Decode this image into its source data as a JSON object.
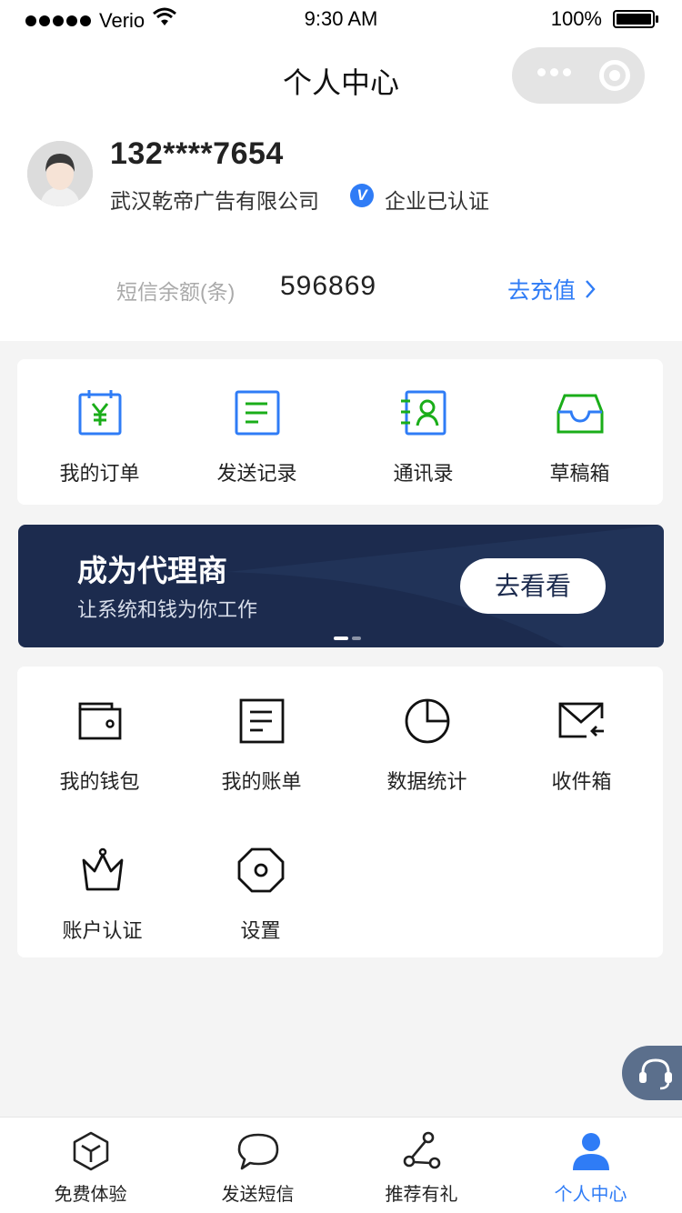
{
  "status_bar": {
    "carrier": "Verio",
    "time": "9:30 AM",
    "battery": "100%"
  },
  "nav": {
    "title": "个人中心",
    "menu_icon": "more-dots-icon",
    "close_icon": "close-target-icon"
  },
  "profile": {
    "phone": "132****7654",
    "company": "武汉乾帝广告有限公司",
    "verified_badge": "V",
    "verified_text": "企业已认证",
    "balance_label": "短信余额(条)",
    "balance_value": "596869",
    "recharge_label": "去充值"
  },
  "quick_menu": [
    {
      "label": "我的订单",
      "icon": "order-icon"
    },
    {
      "label": "发送记录",
      "icon": "record-icon"
    },
    {
      "label": "通讯录",
      "icon": "contacts-icon"
    },
    {
      "label": "草稿箱",
      "icon": "drafts-icon"
    }
  ],
  "banner": {
    "title": "成为代理商",
    "subtitle": "让系统和钱为你工作",
    "button": "去看看"
  },
  "services": [
    {
      "label": "我的钱包",
      "icon": "wallet-icon"
    },
    {
      "label": "我的账单",
      "icon": "bill-icon"
    },
    {
      "label": "数据统计",
      "icon": "pie-chart-icon"
    },
    {
      "label": "收件箱",
      "icon": "inbox-icon"
    },
    {
      "label": "账户认证",
      "icon": "crown-icon"
    },
    {
      "label": "设置",
      "icon": "settings-icon"
    }
  ],
  "tabbar": [
    {
      "label": "免费体验",
      "icon": "cube-icon"
    },
    {
      "label": "发送短信",
      "icon": "chat-bubble-icon"
    },
    {
      "label": "推荐有礼",
      "icon": "share-icon"
    },
    {
      "label": "个人中心",
      "icon": "user-icon",
      "active": true
    }
  ],
  "colors": {
    "accent": "#2f7cf6",
    "banner_bg": "#1c2b4e",
    "icon_green": "#1aad19"
  }
}
